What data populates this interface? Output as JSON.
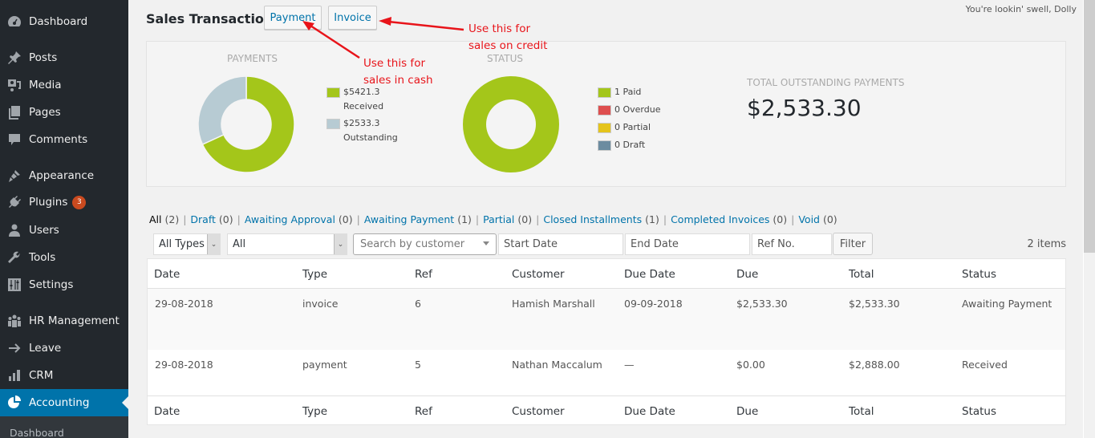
{
  "sidebar": {
    "items": [
      {
        "label": "Dashboard",
        "icon": "dashboard-icon"
      },
      {
        "label": "Posts",
        "icon": "pushpin-icon"
      },
      {
        "label": "Media",
        "icon": "media-icon"
      },
      {
        "label": "Pages",
        "icon": "pages-icon"
      },
      {
        "label": "Comments",
        "icon": "comment-icon"
      },
      {
        "label": "Appearance",
        "icon": "paintbrush-icon"
      },
      {
        "label": "Plugins",
        "icon": "plugin-icon",
        "badge": "3"
      },
      {
        "label": "Users",
        "icon": "user-icon"
      },
      {
        "label": "Tools",
        "icon": "wrench-icon"
      },
      {
        "label": "Settings",
        "icon": "settings-icon"
      },
      {
        "label": "HR Management",
        "icon": "groups-icon"
      },
      {
        "label": "Leave",
        "icon": "arrow-right-icon"
      },
      {
        "label": "CRM",
        "icon": "bar-chart-icon"
      },
      {
        "label": "Accounting",
        "icon": "pie-chart-icon",
        "active": true
      }
    ],
    "submenu": {
      "label": "Dashboard"
    }
  },
  "header": {
    "title": "Sales Transactions",
    "payment_button": "Payment",
    "invoice_button": "Invoice",
    "dolly": "You're lookin' swell, Dolly"
  },
  "annotations": {
    "cash": [
      "Use this for",
      "sales in cash"
    ],
    "credit": [
      "Use this for",
      "sales on credit"
    ],
    "color": "#e8141a"
  },
  "summary": {
    "payments": {
      "title": "PAYMENTS",
      "legend": [
        {
          "value": "$5421.3",
          "label": "Received",
          "color": "#a4c61a",
          "amount": 5421.3
        },
        {
          "value": "$2533.3",
          "label": "Outstanding",
          "color": "#b7cbd3",
          "amount": 2533.3
        }
      ]
    },
    "status": {
      "title": "STATUS",
      "legend": [
        {
          "label": "1 Paid",
          "count": 1,
          "color": "#a4c61a"
        },
        {
          "label": "0 Overdue",
          "count": 0,
          "color": "#de4f4f"
        },
        {
          "label": "0 Partial",
          "count": 0,
          "color": "#e5c41b"
        },
        {
          "label": "0 Draft",
          "count": 0,
          "color": "#6c8ca0"
        }
      ]
    },
    "outstanding": {
      "title": "TOTAL OUTSTANDING PAYMENTS",
      "value": "$2,533.30"
    }
  },
  "status_tabs": [
    {
      "label": "All",
      "count": "(2)",
      "current": true
    },
    {
      "label": "Draft",
      "count": "(0)"
    },
    {
      "label": "Awaiting Approval",
      "count": "(0)"
    },
    {
      "label": "Awaiting Payment",
      "count": "(1)"
    },
    {
      "label": "Partial",
      "count": "(0)"
    },
    {
      "label": "Closed Installments",
      "count": "(1)"
    },
    {
      "label": "Completed Invoices",
      "count": "(0)"
    },
    {
      "label": "Void",
      "count": "(0)"
    }
  ],
  "filters": {
    "type_select": "All Types",
    "status_select": "All",
    "customer_placeholder": "Search by customer",
    "start_date_placeholder": "Start Date",
    "end_date_placeholder": "End Date",
    "ref_placeholder": "Ref No.",
    "filter_button": "Filter",
    "items_count": "2 items"
  },
  "table": {
    "columns": [
      "Date",
      "Type",
      "Ref",
      "Customer",
      "Due Date",
      "Due",
      "Total",
      "Status"
    ],
    "rows": [
      {
        "date": "29-08-2018",
        "type": "invoice",
        "ref": "6",
        "customer": "Hamish Marshall",
        "due_date": "09-09-2018",
        "due": "$2,533.30",
        "total": "$2,533.30",
        "status": "Awaiting Payment"
      },
      {
        "date": "29-08-2018",
        "type": "payment",
        "ref": "5",
        "customer": "Nathan Maccalum",
        "due_date": "—",
        "due": "$0.00",
        "total": "$2,888.00",
        "status": "Received"
      }
    ]
  }
}
